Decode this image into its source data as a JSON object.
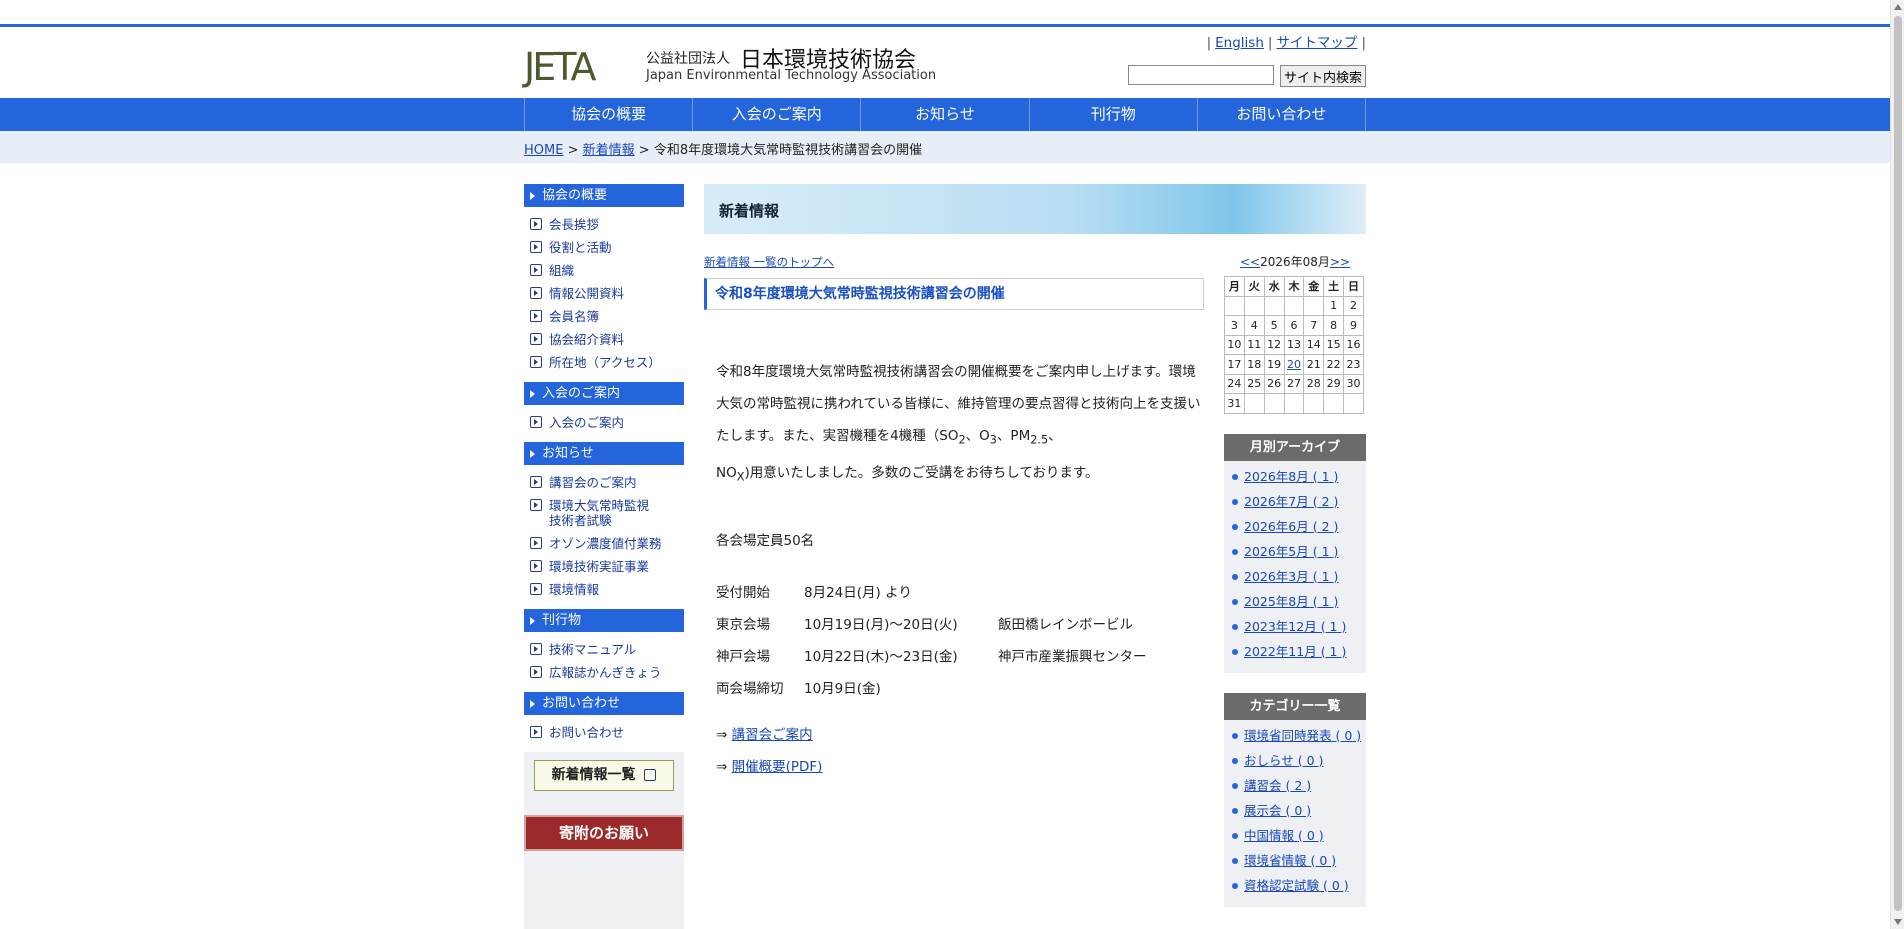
{
  "header": {
    "logo_mark": "JETA",
    "org_type": "公益社団法人",
    "org_name": "日本環境技術協会",
    "org_name_en": "Japan Environmental Technology Association",
    "links": [
      "English",
      "サイトマップ"
    ],
    "search_button": "サイト内検索"
  },
  "nav": [
    "協会の概要",
    "入会のご案内",
    "お知らせ",
    "刊行物",
    "お問い合わせ"
  ],
  "breadcrumb": {
    "home": "HOME",
    "news": "新着情報",
    "current": "令和8年度環境大気常時監視技術講習会の開催",
    "sep": ">"
  },
  "sidebar": {
    "sections": [
      {
        "title": "協会の概要",
        "items": [
          "会長挨拶",
          "役割と活動",
          "組織",
          "情報公開資料",
          "会員名簿",
          "協会紹介資料",
          "所在地（アクセス）"
        ]
      },
      {
        "title": "入会のご案内",
        "items": [
          "入会のご案内"
        ]
      },
      {
        "title": "お知らせ",
        "items": [
          "講習会のご案内",
          "環境大気常時監視技術者試験",
          "オゾン濃度値付業務",
          "環境技術実証事業",
          "環境情報"
        ]
      },
      {
        "title": "刊行物",
        "items": [
          "技術マニュアル",
          "広報誌かんぎきょう"
        ]
      },
      {
        "title": "お問い合わせ",
        "items": [
          "お問い合わせ"
        ]
      }
    ],
    "news_list_button": "新着情報一覧",
    "donation_button": "寄附のお願い"
  },
  "main": {
    "banner_title": "新着情報",
    "back_link": "新着情報 一覧のトップへ",
    "article_title": "令和8年度環境大気常時監視技術講習会の開催",
    "body_p1": "令和8年度環境大気常時監視技術講習会の開催概要をご案内申し上げます。環境大気の常時監視に携われている皆様に、維持管理の要点習得と技術向上を支援いたします。また、実習機種を4機種（",
    "so": "SO",
    "so_sub": "2",
    "o": "、O",
    "o_sub": "3",
    "pm": "、PM",
    "pm_sub": "2.5",
    "sep2": "、",
    "no": "NO",
    "no_sub": "X",
    "body_p2": ")用意いたしました。多数のご受講をお待ちしております。",
    "capacity": "各会場定員50名",
    "schedule": [
      {
        "label": "受付開始",
        "date": "8月24日(月) より",
        "venue": ""
      },
      {
        "label": "東京会場",
        "date": "10月19日(月)～20日(火)",
        "venue": "飯田橋レインボービル"
      },
      {
        "label": "神戸会場",
        "date": "10月22日(木)～23日(金)",
        "venue": "神戸市産業振興センター"
      },
      {
        "label": "両会場締切",
        "date": "10月9日(金)",
        "venue": ""
      }
    ],
    "arrow": "⇒",
    "links": [
      "講習会ご案内",
      "開催概要(PDF)"
    ]
  },
  "calendar": {
    "prev": "<<",
    "next": ">>",
    "month": "2026年08月",
    "days": [
      "月",
      "火",
      "水",
      "木",
      "金",
      "土",
      "日"
    ],
    "weeks": [
      [
        "",
        "",
        "",
        "",
        "",
        "1",
        "2"
      ],
      [
        "3",
        "4",
        "5",
        "6",
        "7",
        "8",
        "9"
      ],
      [
        "10",
        "11",
        "12",
        "13",
        "14",
        "15",
        "16"
      ],
      [
        "17",
        "18",
        "19",
        "20",
        "21",
        "22",
        "23"
      ],
      [
        "24",
        "25",
        "26",
        "27",
        "28",
        "29",
        "30"
      ],
      [
        "31",
        "",
        "",
        "",
        "",
        "",
        ""
      ]
    ],
    "linked_day": "20"
  },
  "archive": {
    "title": "月別アーカイブ",
    "items": [
      "2026年8月 ( 1 )",
      "2026年7月 ( 2 )",
      "2026年6月 ( 2 )",
      "2026年5月 ( 1 )",
      "2026年3月 ( 1 )",
      "2025年8月 ( 1 )",
      "2023年12月 ( 1 )",
      "2022年11月 ( 1 )"
    ]
  },
  "categories": {
    "title": "カテゴリー一覧",
    "items": [
      "環境省同時発表 ( 0 )",
      "おしらせ ( 0 )",
      "講習会 ( 2 )",
      "展示会 ( 0 )",
      "中国情報 ( 0 )",
      "環境省情報 ( 0 )",
      "資格認定試験 ( 0 )"
    ]
  }
}
